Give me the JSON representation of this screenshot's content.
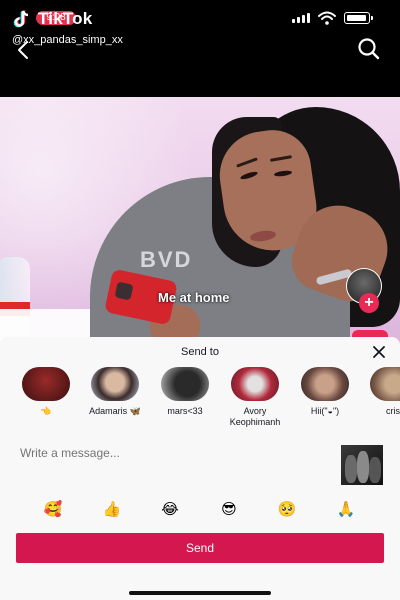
{
  "status_bar": {
    "time": "9:08"
  },
  "watermark": {
    "brand": "TikTok",
    "username": "@xx_pandas_simp_xx"
  },
  "video": {
    "caption": "Me at home",
    "shirt_text": "BVD"
  },
  "share_sheet": {
    "title": "Send to",
    "contacts": [
      {
        "name": "👈"
      },
      {
        "name": "Adamaris 🦋"
      },
      {
        "name": "mars<33"
      },
      {
        "name": "Avory Keophimanh"
      },
      {
        "name": "Hii(\"◒\")"
      },
      {
        "name": "cris"
      }
    ],
    "message_placeholder": "Write a message...",
    "emojis": [
      "🥰",
      "👍",
      "😂",
      "😎",
      "🥺",
      "🙏"
    ],
    "send_label": "Send"
  },
  "colors": {
    "accent": "#d4184f",
    "follow": "#ea2a55",
    "time_pill": "#e0344e"
  },
  "icons": [
    "back-icon",
    "search-icon",
    "close-icon",
    "tiktok-logo-icon",
    "signal-icon",
    "wifi-icon",
    "battery-icon",
    "plus-icon"
  ]
}
